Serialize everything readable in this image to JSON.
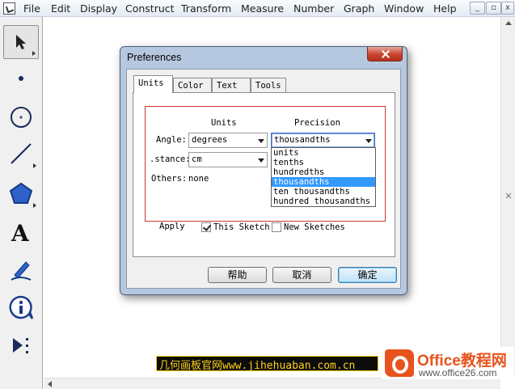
{
  "menubar": {
    "items": [
      "File",
      "Edit",
      "Display",
      "Construct",
      "Transform",
      "Measure",
      "Number",
      "Graph",
      "Window",
      "Help"
    ],
    "window_buttons": [
      "_",
      "▫",
      "x"
    ]
  },
  "toolbox": {
    "tools": [
      "selection-arrow",
      "point",
      "compass",
      "straightedge",
      "polygon",
      "text",
      "marker",
      "information",
      "custom-tools"
    ]
  },
  "dialog": {
    "title": "Preferences",
    "tabs": [
      "Units",
      "Color",
      "Text",
      "Tools"
    ],
    "active_tab": "Units",
    "columns": {
      "units": "Units",
      "precision": "Precision"
    },
    "rows": {
      "angle": {
        "label": "Angle:",
        "unit": "degrees",
        "precision": "thousandths"
      },
      "distance": {
        "label": ".stance:",
        "unit": "cm"
      },
      "others": {
        "label": "Others:",
        "value": "none"
      }
    },
    "precision_options": [
      "units",
      "tenths",
      "hundredths",
      "thousandths",
      "ten thousandths",
      "hundred thousandths"
    ],
    "precision_selected_index": 3,
    "apply": {
      "label": "Apply",
      "this_sketch": {
        "label": "This Sketch",
        "checked": true
      },
      "new_sketches": {
        "label": "New Sketches",
        "checked": false
      }
    },
    "buttons": {
      "help": "帮助",
      "cancel": "取消",
      "ok": "确定"
    }
  },
  "watermark": {
    "banner": "几何画板官网www.jihehuaban.com.cn",
    "brand": "Office教程网",
    "url": "www.office26.com"
  }
}
